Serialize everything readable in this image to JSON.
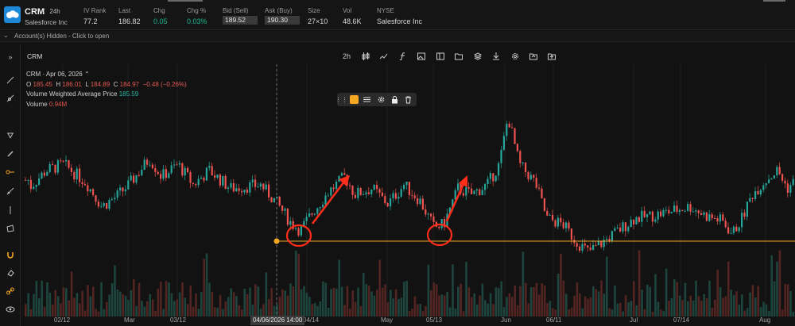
{
  "header": {
    "symbol": "CRM",
    "timeframe_badge": "24h",
    "company": "Salesforce Inc",
    "fields": [
      {
        "label": "IV Rank",
        "value": "77.2"
      },
      {
        "label": "Last",
        "value": "186.82"
      },
      {
        "label": "Chg",
        "value": "0.05"
      },
      {
        "label": "Chg %",
        "value": "0.03%"
      },
      {
        "label": "Bid (Sell)",
        "value": "189.52"
      },
      {
        "label": "Ask (Buy)",
        "value": "190.30"
      },
      {
        "label": "Size",
        "value": "27×10"
      },
      {
        "label": "Vol",
        "value": "48.6K"
      },
      {
        "label": "NYSE",
        "value": "Salesforce Inc"
      }
    ]
  },
  "accounts_bar": {
    "text": "Account(s) Hidden - Click to open"
  },
  "chart_header": {
    "symbol_tab": "CRM",
    "interval": "2h"
  },
  "legend": {
    "title": "CRM · Apr 06, 2026",
    "o_label": "O",
    "o": "185.45",
    "h_label": "H",
    "h": "186.01",
    "l_label": "L",
    "l": "184.89",
    "c_label": "C",
    "c": "184.97",
    "change": "−0.48 (−0.26%)",
    "vwap_label": "Volume Weighted Average Price",
    "vwap": "185.59",
    "volume_label": "Volume",
    "volume": "0.94M"
  },
  "crosshair_date": "04/06/2026 14:00",
  "x_ticks": [
    "02/12",
    "Mar",
    "03/12",
    "04/14",
    "May",
    "05/13",
    "Jun",
    "06/11",
    "Jul",
    "07/14",
    "Aug"
  ],
  "colors": {
    "up": "#26a69a",
    "down": "#ef5350",
    "support_line": "#f5a623",
    "annotation": "#ff2d1a",
    "background": "#121212"
  },
  "icons": {
    "left_toolbar": [
      "expand-icon",
      "trendline-icon",
      "ray-icon",
      "pitchfork-icon",
      "brush-icon",
      "horizontal-ray-icon",
      "extended-line-icon",
      "vertical-line-icon",
      "rectangle-icon",
      "magnet-icon",
      "eraser-icon",
      "link-icon",
      "eye-icon"
    ],
    "chart_toolbar": [
      "candles-icon",
      "indicators-icon",
      "function-icon",
      "image-icon",
      "layout-icon",
      "folder-icon",
      "layers-icon",
      "download-icon",
      "settings-icon",
      "open-folder-icon",
      "upload-folder-icon"
    ]
  },
  "chart_data": {
    "type": "candlestick",
    "symbol": "CRM",
    "interval": "2h",
    "x_ticks": [
      "02/12",
      "Mar",
      "03/12",
      "04/14",
      "May",
      "05/13",
      "Jun",
      "06/11",
      "Jul",
      "07/14",
      "Aug"
    ],
    "approx_close_path": [
      {
        "x": "02/12",
        "y": 188
      },
      {
        "x": "Mar",
        "y": 186
      },
      {
        "x": "03/12",
        "y": 188
      },
      {
        "x": "04/06",
        "y": 185
      },
      {
        "x": "04/14",
        "y": 183
      },
      {
        "x": "May",
        "y": 185
      },
      {
        "x": "05/13",
        "y": 183
      },
      {
        "x": "Jun",
        "y": 190
      },
      {
        "x": "06/11",
        "y": 182
      },
      {
        "x": "Jul",
        "y": 183
      },
      {
        "x": "07/14",
        "y": 184
      },
      {
        "x": "Aug",
        "y": 187
      }
    ],
    "support_level": 184.3,
    "volume_visible": true,
    "annotations": [
      "circle-04/14",
      "arrow-up-04/14",
      "circle-05/13",
      "arrow-up-05/13",
      "support-line-from-04/06"
    ]
  }
}
